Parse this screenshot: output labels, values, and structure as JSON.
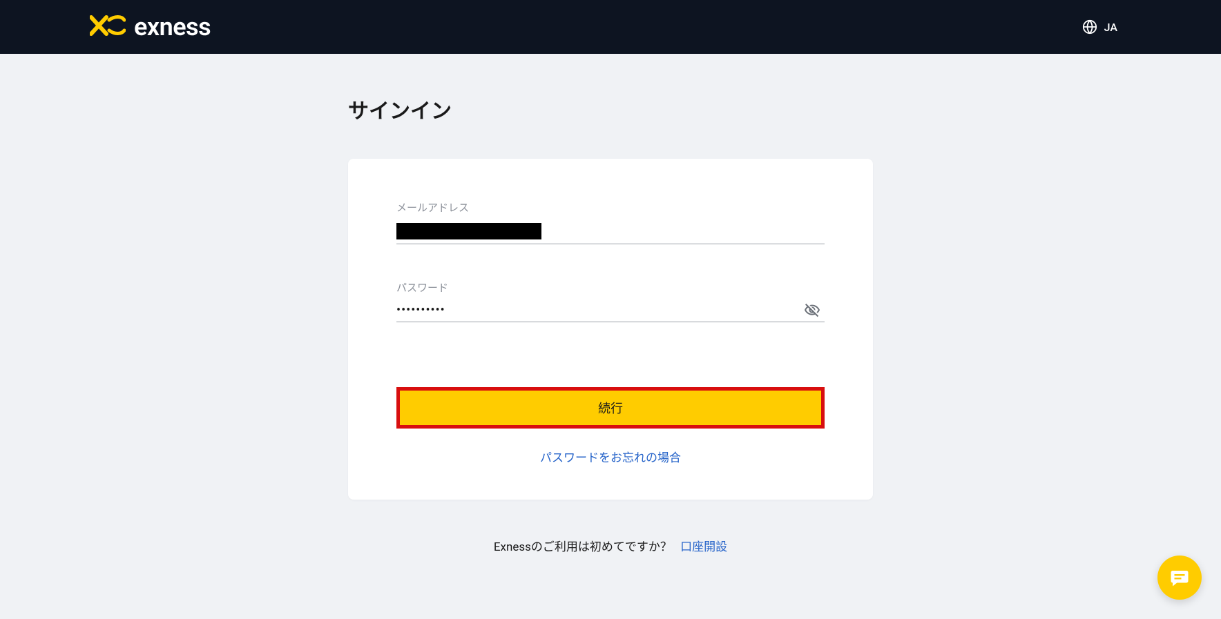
{
  "header": {
    "brand_name": "exness",
    "language_label": "JA"
  },
  "page": {
    "title": "サインイン"
  },
  "form": {
    "email_label": "メールアドレス",
    "email_value_redacted": true,
    "password_label": "パスワード",
    "password_value_masked": "••••••••••",
    "continue_label": "続行",
    "forgot_password_label": "パスワードをお忘れの場合"
  },
  "signup": {
    "prompt": "Exnessのご利用は初めてですか？",
    "link_label": "口座開設"
  },
  "colors": {
    "accent": "#ffcc00",
    "highlight_border": "#d80f0f",
    "link": "#2563c9",
    "header_bg": "#0d1421"
  },
  "icons": {
    "globe": "globe-icon",
    "eye_off": "eye-off-icon",
    "chat": "chat-icon",
    "logo": "exness-logo-icon"
  }
}
